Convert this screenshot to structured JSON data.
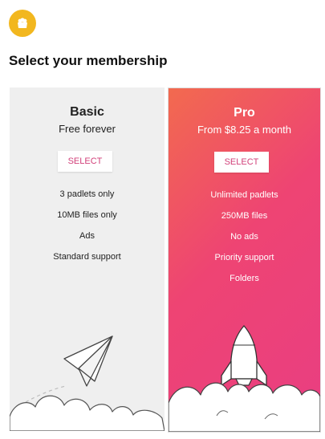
{
  "logo": {
    "icon": "padlet-logo-icon",
    "color": "#F2B71F"
  },
  "page_title": "Select your membership",
  "plans": [
    {
      "name": "Basic",
      "subtitle": "Free forever",
      "select_label": "SELECT",
      "features": [
        "3 padlets only",
        "10MB files only",
        "Ads",
        "Standard support"
      ],
      "illustration": "paper-plane-icon"
    },
    {
      "name": "Pro",
      "subtitle": "From $8.25 a month",
      "select_label": "SELECT",
      "features": [
        "Unlimited padlets",
        "250MB files",
        "No ads",
        "Priority support",
        "Folders"
      ],
      "illustration": "rocket-icon",
      "gradient": [
        "#F26A4F",
        "#E93E82"
      ]
    }
  ],
  "colors": {
    "accent": "#D2407A"
  }
}
